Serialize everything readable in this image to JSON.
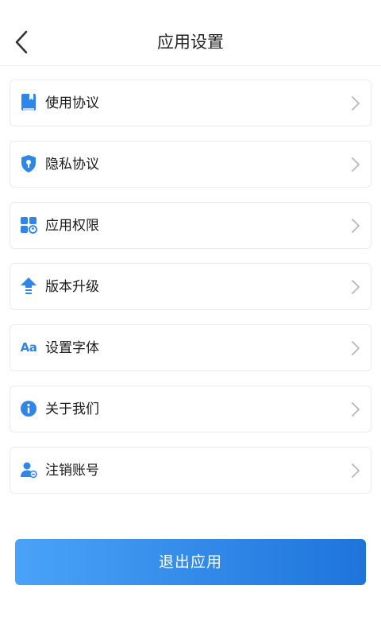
{
  "header": {
    "title": "应用设置"
  },
  "items": [
    {
      "label": "使用协议",
      "icon": "book-icon"
    },
    {
      "label": "隐私协议",
      "icon": "shield-lock-icon"
    },
    {
      "label": "应用权限",
      "icon": "app-grid-icon"
    },
    {
      "label": "版本升级",
      "icon": "upgrade-arrow-icon"
    },
    {
      "label": "设置字体",
      "icon": "font-aa-icon"
    },
    {
      "label": "关于我们",
      "icon": "info-icon"
    },
    {
      "label": "注销账号",
      "icon": "user-remove-icon"
    }
  ],
  "footer": {
    "logout_label": "退出应用"
  },
  "colors": {
    "accent": "#2f86e6",
    "gradient_start": "#4aa3f8",
    "gradient_end": "#1e74db"
  },
  "icons": {
    "font_icon_text": "Aa"
  }
}
